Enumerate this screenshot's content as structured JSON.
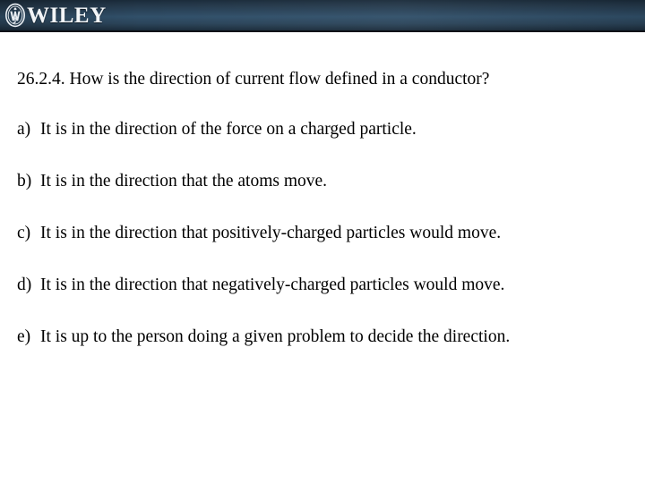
{
  "slide": {
    "banner": {
      "brand_name": "WILEY",
      "logo_icon": "wiley-circular-monogram-icon",
      "gradient_top_color": "#1a2b3a",
      "gradient_mid_color": "#31506a",
      "gradient_bottom_color": "#10181f",
      "brand_text_color": "#f2f5f8"
    },
    "background_color": "#ffffff",
    "text_color": "#000000",
    "question": {
      "number": "26.2.4.",
      "text": "How is the direction of current flow defined in a conductor?",
      "full": "26.2.4. How is the direction of current flow defined in a conductor?"
    },
    "choices": [
      {
        "label": "a)",
        "text": "It is in the direction of the force on a charged particle."
      },
      {
        "label": "b)",
        "text": "It is in the direction that the atoms move."
      },
      {
        "label": "c)",
        "text": "It is in the direction that positively-charged particles would move."
      },
      {
        "label": "d)",
        "text": "It is in the direction that negatively-charged particles would move."
      },
      {
        "label": "e)",
        "text": "It is up to the person doing a given problem to decide the direction."
      }
    ]
  }
}
